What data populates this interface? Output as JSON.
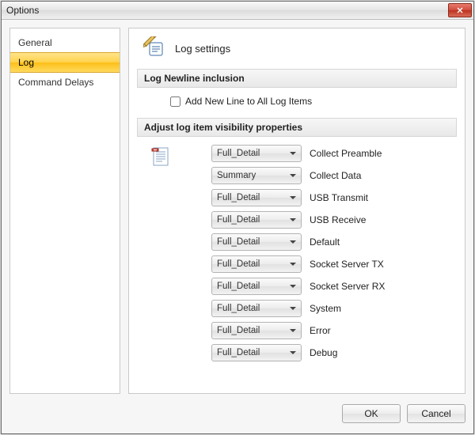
{
  "window": {
    "title": "Options"
  },
  "sidebar": {
    "items": [
      {
        "label": "General",
        "selected": false
      },
      {
        "label": "Log",
        "selected": true
      },
      {
        "label": "Command Delays",
        "selected": false
      }
    ]
  },
  "page": {
    "title": "Log settings",
    "section_newline": {
      "heading": "Log Newline inclusion",
      "checkbox_label": "Add New Line to All Log Items",
      "checked": false
    },
    "section_visibility": {
      "heading": "Adjust log item visibility properties",
      "rows": [
        {
          "value": "Full_Detail",
          "label": "Collect Preamble"
        },
        {
          "value": "Summary",
          "label": "Collect Data"
        },
        {
          "value": "Full_Detail",
          "label": "USB Transmit"
        },
        {
          "value": "Full_Detail",
          "label": "USB Receive"
        },
        {
          "value": "Full_Detail",
          "label": "Default"
        },
        {
          "value": "Full_Detail",
          "label": "Socket Server TX"
        },
        {
          "value": "Full_Detail",
          "label": "Socket Server RX"
        },
        {
          "value": "Full_Detail",
          "label": "System"
        },
        {
          "value": "Full_Detail",
          "label": "Error"
        },
        {
          "value": "Full_Detail",
          "label": "Debug"
        }
      ]
    }
  },
  "footer": {
    "ok_label": "OK",
    "cancel_label": "Cancel"
  }
}
